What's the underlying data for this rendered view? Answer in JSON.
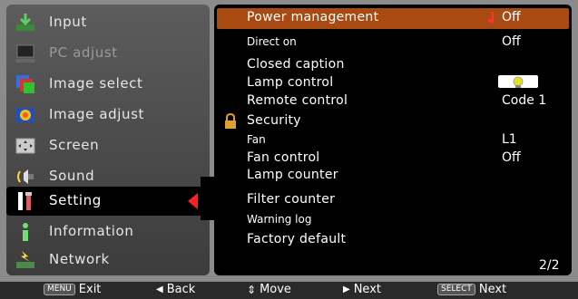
{
  "left_menu": {
    "items": [
      {
        "label": "Input",
        "icon": "input-icon"
      },
      {
        "label": "PC adjust",
        "icon": "pc-adjust-icon"
      },
      {
        "label": "Image select",
        "icon": "image-select-icon"
      },
      {
        "label": "Image adjust",
        "icon": "image-adjust-icon"
      },
      {
        "label": "Screen",
        "icon": "screen-icon"
      },
      {
        "label": "Sound",
        "icon": "sound-icon"
      },
      {
        "label": "Setting",
        "icon": "setting-icon"
      },
      {
        "label": "Information",
        "icon": "information-icon"
      },
      {
        "label": "Network",
        "icon": "network-icon"
      }
    ],
    "selected": "Setting"
  },
  "settings": {
    "items": [
      {
        "label": "Power management",
        "value": "Off"
      },
      {
        "label": "Direct on",
        "value": "Off"
      },
      {
        "label": "Closed caption",
        "value": ""
      },
      {
        "label": "Lamp control",
        "value": ""
      },
      {
        "label": "Remote control",
        "value": "Code 1"
      },
      {
        "label": "Security",
        "value": ""
      },
      {
        "label": "Fan",
        "value": "L1"
      },
      {
        "label": "Fan control",
        "value": "Off"
      },
      {
        "label": "Lamp counter",
        "value": ""
      },
      {
        "label": "Filter counter",
        "value": ""
      },
      {
        "label": "Warning log",
        "value": ""
      },
      {
        "label": "Factory default",
        "value": ""
      }
    ],
    "page": "2/2"
  },
  "footer": {
    "exit_key": "MENU",
    "exit_label": "Exit",
    "back_label": "Back",
    "move_label": "Move",
    "next_label": "Next",
    "select_key": "SELECT",
    "select_next_label": "Next"
  },
  "colors": {
    "highlight": "#a84a12",
    "pointer": "#ff2020"
  }
}
